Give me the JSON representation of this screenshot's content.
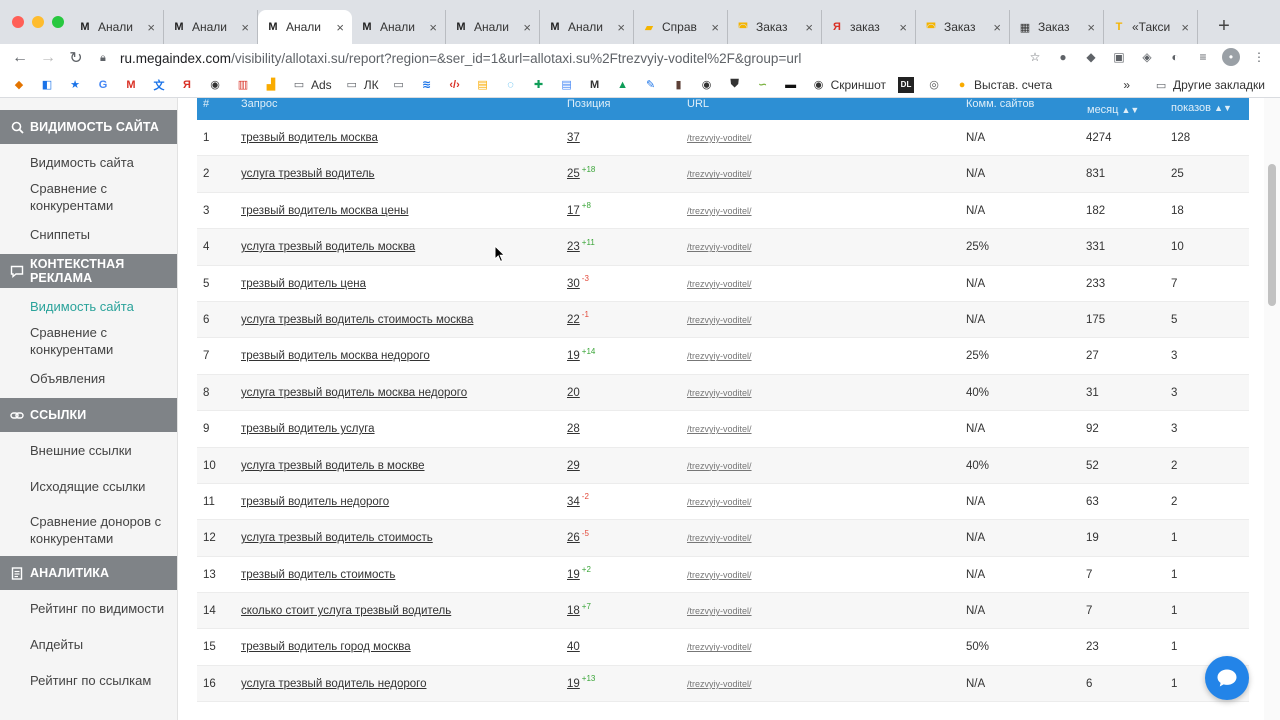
{
  "tabs": [
    {
      "title": "Анали",
      "icon": "megaindex-icon",
      "active": false
    },
    {
      "title": "Анали",
      "icon": "megaindex-icon",
      "active": false
    },
    {
      "title": "Анали",
      "icon": "megaindex-icon",
      "active": true
    },
    {
      "title": "Анали",
      "icon": "megaindex-icon",
      "active": false
    },
    {
      "title": "Анали",
      "icon": "megaindex-icon",
      "active": false
    },
    {
      "title": "Анали",
      "icon": "megaindex-icon",
      "active": false
    },
    {
      "title": "Справ",
      "icon": "taxi-icon",
      "active": false
    },
    {
      "title": "Заказ",
      "icon": "taxi-car-icon",
      "active": false
    },
    {
      "title": "заказ",
      "icon": "yandex-icon",
      "active": false
    },
    {
      "title": "Заказ",
      "icon": "taxi-car-icon",
      "active": false
    },
    {
      "title": "Заказ",
      "icon": "site-icon",
      "active": false
    },
    {
      "title": "«Такси",
      "icon": "taxi-logo-icon",
      "active": false
    }
  ],
  "address": {
    "host": "ru.megaindex.com",
    "path": "/visibility/allotaxi.su/report?region=&ser_id=1&url=allotaxi.su%2Ftrezvyiy-voditel%2F&group=url"
  },
  "bookmarks": {
    "ads": "Ads",
    "lk": "ЛК",
    "screenshot": "Скриншот",
    "dl": "DL",
    "invoices": "Выстав. счета",
    "more": "»",
    "other": "Другие закладки"
  },
  "sidebar": {
    "visibility_head": "ВИДИМОСТЬ САЙТА",
    "visibility_items": [
      "Видимость сайта",
      "Сравнение с конкурентами",
      "Сниппеты"
    ],
    "context_head": "КОНТЕКСТНАЯ РЕКЛАМА",
    "context_items": [
      "Видимость сайта",
      "Сравнение с конкурентами",
      "Объявления"
    ],
    "links_head": "ССЫЛКИ",
    "links_items": [
      "Внешние ссылки",
      "Исходящие ссылки",
      "Сравнение доноров с конкурентами"
    ],
    "analytics_head": "АНАЛИТИКА",
    "analytics_items": [
      "Рейтинг по видимости",
      "Апдейты",
      "Рейтинг по ссылкам"
    ]
  },
  "table": {
    "headers": {
      "num": "#",
      "query": "Запрос",
      "position": "Позиция",
      "url": "URL",
      "comm": "Комм. сайтов",
      "month": "месяц",
      "shows": "показов"
    },
    "rows": [
      {
        "n": "1",
        "query": "трезвый водитель москва",
        "pos": "37",
        "delta": "",
        "url": "/trezvyiy-voditel/",
        "comm": "N/A",
        "month": "4274",
        "shows": "128"
      },
      {
        "n": "2",
        "query": "услуга трезвый водитель",
        "pos": "25",
        "delta": "+18",
        "url": "/trezvyiy-voditel/",
        "comm": "N/A",
        "month": "831",
        "shows": "25"
      },
      {
        "n": "3",
        "query": "трезвый водитель москва цены",
        "pos": "17",
        "delta": "+8",
        "url": "/trezvyiy-voditel/",
        "comm": "N/A",
        "month": "182",
        "shows": "18"
      },
      {
        "n": "4",
        "query": "услуга трезвый водитель москва",
        "pos": "23",
        "delta": "+11",
        "url": "/trezvyiy-voditel/",
        "comm": "25%",
        "month": "331",
        "shows": "10"
      },
      {
        "n": "5",
        "query": "трезвый водитель цена",
        "pos": "30",
        "delta": "-3",
        "url": "/trezvyiy-voditel/",
        "comm": "N/A",
        "month": "233",
        "shows": "7"
      },
      {
        "n": "6",
        "query": "услуга трезвый водитель стоимость москва",
        "pos": "22",
        "delta": "-1",
        "url": "/trezvyiy-voditel/",
        "comm": "N/A",
        "month": "175",
        "shows": "5"
      },
      {
        "n": "7",
        "query": "трезвый водитель москва недорого",
        "pos": "19",
        "delta": "+14",
        "url": "/trezvyiy-voditel/",
        "comm": "25%",
        "month": "27",
        "shows": "3"
      },
      {
        "n": "8",
        "query": "услуга трезвый водитель москва недорого",
        "pos": "20",
        "delta": "",
        "url": "/trezvyiy-voditel/",
        "comm": "40%",
        "month": "31",
        "shows": "3"
      },
      {
        "n": "9",
        "query": "трезвый водитель услуга",
        "pos": "28",
        "delta": "",
        "url": "/trezvyiy-voditel/",
        "comm": "N/A",
        "month": "92",
        "shows": "3"
      },
      {
        "n": "10",
        "query": "услуга трезвый водитель в москве",
        "pos": "29",
        "delta": "",
        "url": "/trezvyiy-voditel/",
        "comm": "40%",
        "month": "52",
        "shows": "2"
      },
      {
        "n": "11",
        "query": "трезвый водитель недорого",
        "pos": "34",
        "delta": "-2",
        "url": "/trezvyiy-voditel/",
        "comm": "N/A",
        "month": "63",
        "shows": "2"
      },
      {
        "n": "12",
        "query": "услуга трезвый водитель стоимость",
        "pos": "26",
        "delta": "-5",
        "url": "/trezvyiy-voditel/",
        "comm": "N/A",
        "month": "19",
        "shows": "1"
      },
      {
        "n": "13",
        "query": "трезвый водитель стоимость",
        "pos": "19",
        "delta": "+2",
        "url": "/trezvyiy-voditel/",
        "comm": "N/A",
        "month": "7",
        "shows": "1"
      },
      {
        "n": "14",
        "query": "сколько стоит услуга трезвый водитель",
        "pos": "18",
        "delta": "+7",
        "url": "/trezvyiy-voditel/",
        "comm": "N/A",
        "month": "7",
        "shows": "1"
      },
      {
        "n": "15",
        "query": "трезвый водитель город москва",
        "pos": "40",
        "delta": "",
        "url": "/trezvyiy-voditel/",
        "comm": "50%",
        "month": "23",
        "shows": "1"
      },
      {
        "n": "16",
        "query": "услуга трезвый водитель недорого",
        "pos": "19",
        "delta": "+13",
        "url": "/trezvyiy-voditel/",
        "comm": "N/A",
        "month": "6",
        "shows": "1"
      }
    ]
  },
  "colors": {
    "header_blue": "#2d8fd4",
    "sidebar_head": "#7f8387",
    "active_link": "#2ba39b",
    "delta_up": "#3aa538",
    "delta_down": "#e24a3b",
    "chat_button": "#2384e8"
  }
}
